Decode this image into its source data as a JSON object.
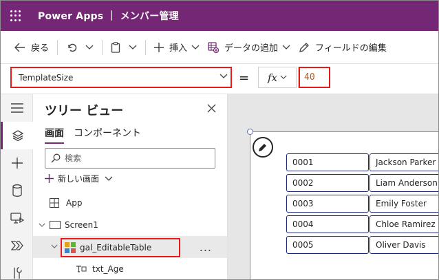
{
  "titlebar": {
    "title": "Power Apps ｜ メンバー管理"
  },
  "toolbar": {
    "back_label": "戻る",
    "insert_label": "挿入",
    "add_data_label": "データの追加",
    "field_edit_label": "フィールドの編集"
  },
  "formula": {
    "property": "TemplateSize",
    "equals": "=",
    "fx": "fx",
    "value": "40"
  },
  "tree": {
    "title": "ツリー ビュー",
    "tabs": [
      "画面",
      "コンポーネント"
    ],
    "search_placeholder": "検索",
    "new_screen": "新しい画面",
    "items": [
      {
        "label": "App"
      },
      {
        "label": "Screen1"
      },
      {
        "label": "gal_EditableTable"
      },
      {
        "label": "txt_Age"
      }
    ],
    "more": "..."
  },
  "gallery": {
    "rows": [
      {
        "id": "0001",
        "name": "Jackson Parker"
      },
      {
        "id": "0002",
        "name": "Liam Anderson"
      },
      {
        "id": "0003",
        "name": "Emily Foster"
      },
      {
        "id": "0004",
        "name": "Chloe Ramirez"
      },
      {
        "id": "0005",
        "name": "Oliver Davis"
      }
    ]
  },
  "colors": {
    "brand": "#742774",
    "highlight": "#e8191b",
    "cell_border": "#1e2a78",
    "formula_value": "#b35a1f"
  },
  "icons": {
    "waffle": "waffle-icon",
    "back": "back-arrow-icon",
    "undo": "undo-icon",
    "paste": "paste-icon",
    "insert": "plus-icon",
    "data": "database-add-icon",
    "field": "pencil-field-icon",
    "tree": "layers-icon",
    "edit": "pencil-icon"
  }
}
